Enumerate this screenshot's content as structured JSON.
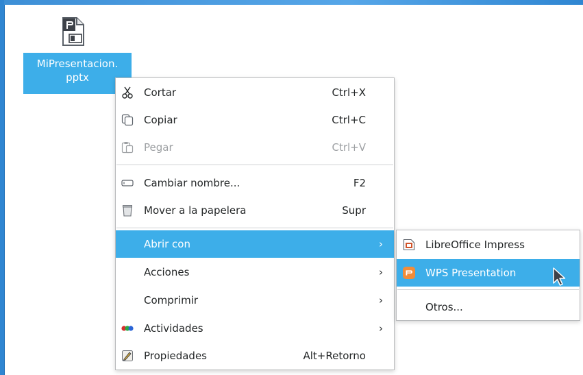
{
  "desktop": {
    "file": {
      "name_line1": "MiPresentacion.",
      "name_line2": "pptx",
      "icon": "presentation-file-icon"
    }
  },
  "context_menu": {
    "items": [
      {
        "label": "Cortar",
        "shortcut": "Ctrl+X",
        "icon": "scissors-icon"
      },
      {
        "label": "Copiar",
        "shortcut": "Ctrl+C",
        "icon": "copy-icon"
      },
      {
        "label": "Pegar",
        "shortcut": "Ctrl+V",
        "icon": "paste-icon",
        "disabled": true
      },
      {
        "label": "Cambiar nombre...",
        "shortcut": "F2",
        "icon": "rename-icon"
      },
      {
        "label": "Mover a la papelera",
        "shortcut": "Supr",
        "icon": "trash-icon"
      },
      {
        "label": "Abrir con",
        "submenu": true,
        "active": true
      },
      {
        "label": "Acciones",
        "submenu": true
      },
      {
        "label": "Comprimir",
        "submenu": true
      },
      {
        "label": "Actividades",
        "submenu": true,
        "icon": "activities-icon"
      },
      {
        "label": "Propiedades",
        "shortcut": "Alt+Retorno",
        "icon": "properties-icon"
      }
    ],
    "arrow": "›"
  },
  "open_with_submenu": {
    "items": [
      {
        "label": "LibreOffice Impress",
        "icon": "libreoffice-impress-icon"
      },
      {
        "label": "WPS Presentation",
        "icon": "wps-presentation-icon",
        "active": true
      },
      {
        "label": "Otros..."
      }
    ]
  },
  "colors": {
    "selection": "#3daee9",
    "wps_orange": "#f28c38",
    "impress_orange": "#d0542b"
  }
}
